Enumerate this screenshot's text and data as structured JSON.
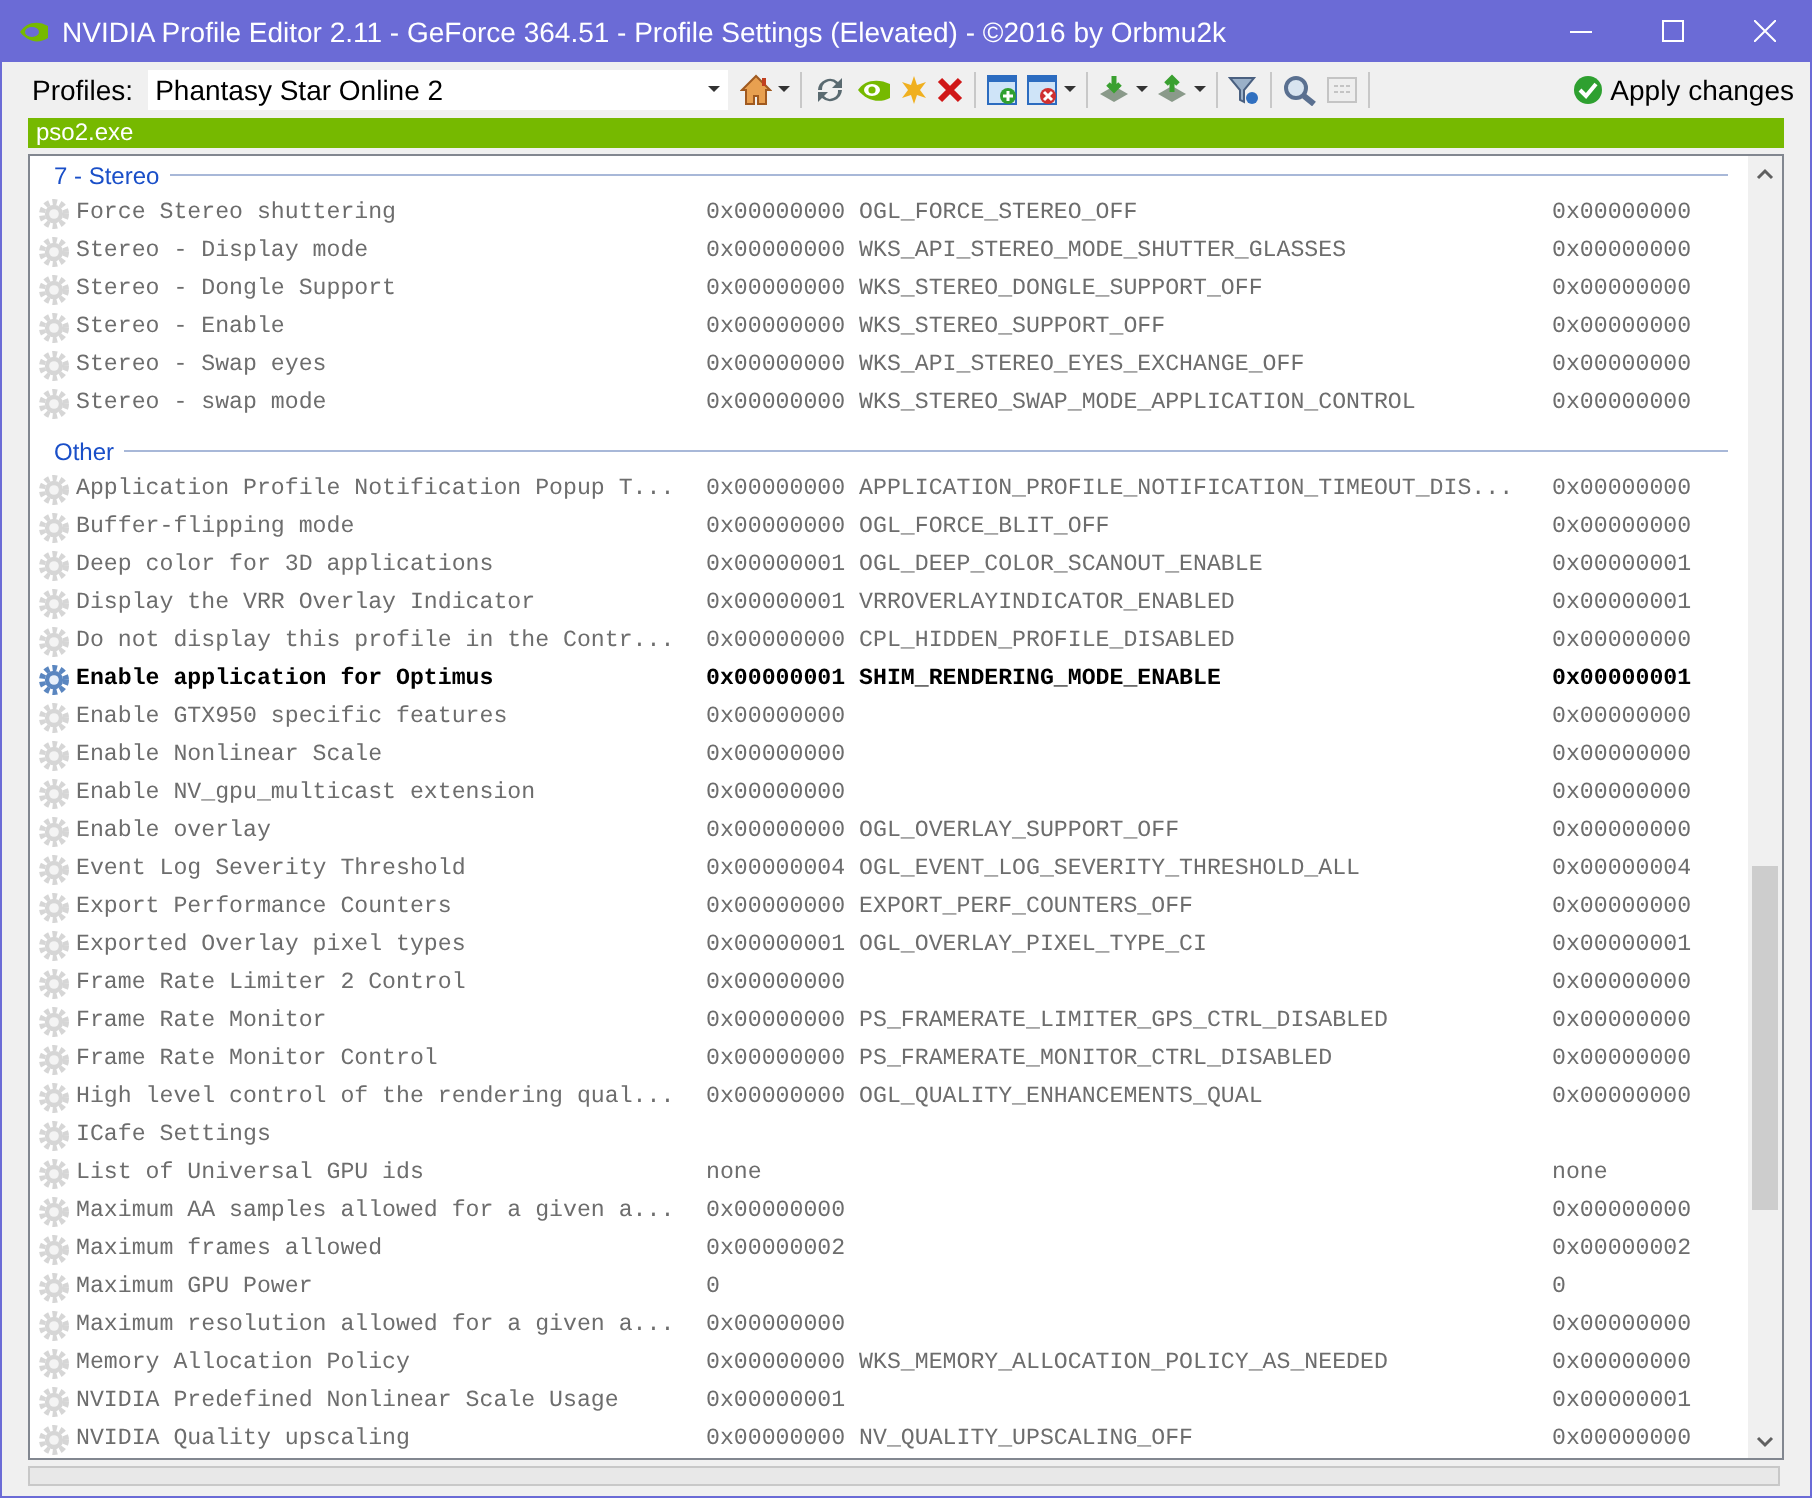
{
  "window": {
    "title": "NVIDIA Profile Editor 2.11 - GeForce 364.51 - Profile Settings (Elevated) - ©2016 by Orbmu2k"
  },
  "toolbar": {
    "profiles_label": "Profiles:",
    "profile": "Phantasy Star Online 2",
    "apply_button": "Apply changes",
    "buttons": [
      {
        "kind": "home",
        "dropdown": true,
        "disabled": false
      },
      {
        "kind": "refresh",
        "dropdown": false,
        "disabled": false
      },
      {
        "kind": "logo",
        "dropdown": false,
        "disabled": false
      },
      {
        "kind": "new",
        "dropdown": false,
        "disabled": false
      },
      {
        "kind": "delete",
        "dropdown": false,
        "disabled": false
      },
      {
        "kind": "add-app",
        "dropdown": false,
        "disabled": false
      },
      {
        "kind": "remove-app",
        "dropdown": true,
        "disabled": false
      },
      {
        "kind": "import",
        "dropdown": true,
        "disabled": false
      },
      {
        "kind": "export",
        "dropdown": true,
        "disabled": false
      },
      {
        "kind": "filter",
        "dropdown": false,
        "disabled": false
      },
      {
        "kind": "scan",
        "dropdown": false,
        "disabled": false
      },
      {
        "kind": "grid",
        "dropdown": false,
        "disabled": true
      }
    ]
  },
  "application_bar": {
    "label": "pso2.exe"
  },
  "groups": [
    {
      "title": "7 - Stereo",
      "rows": [
        {
          "name": "Force Stereo shuttering",
          "value": "0x00000000 OGL_FORCE_STEREO_OFF",
          "default": "0x00000000",
          "configured": false
        },
        {
          "name": "Stereo - Display mode",
          "value": "0x00000000 WKS_API_STEREO_MODE_SHUTTER_GLASSES",
          "default": "0x00000000",
          "configured": false
        },
        {
          "name": "Stereo - Dongle Support",
          "value": "0x00000000 WKS_STEREO_DONGLE_SUPPORT_OFF",
          "default": "0x00000000",
          "configured": false
        },
        {
          "name": "Stereo - Enable",
          "value": "0x00000000 WKS_STEREO_SUPPORT_OFF",
          "default": "0x00000000",
          "configured": false
        },
        {
          "name": "Stereo - Swap eyes",
          "value": "0x00000000 WKS_API_STEREO_EYES_EXCHANGE_OFF",
          "default": "0x00000000",
          "configured": false
        },
        {
          "name": "Stereo - swap mode",
          "value": "0x00000000 WKS_STEREO_SWAP_MODE_APPLICATION_CONTROL",
          "default": "0x00000000",
          "configured": false
        }
      ]
    },
    {
      "title": "Other",
      "rows": [
        {
          "name": "Application Profile Notification Popup T...",
          "value": "0x00000000 APPLICATION_PROFILE_NOTIFICATION_TIMEOUT_DIS...",
          "default": "0x00000000",
          "configured": false
        },
        {
          "name": "Buffer-flipping mode",
          "value": "0x00000000 OGL_FORCE_BLIT_OFF",
          "default": "0x00000000",
          "configured": false
        },
        {
          "name": "Deep color for 3D applications",
          "value": "0x00000001 OGL_DEEP_COLOR_SCANOUT_ENABLE",
          "default": "0x00000001",
          "configured": false
        },
        {
          "name": "Display the VRR Overlay Indicator",
          "value": "0x00000001 VRROVERLAYINDICATOR_ENABLED",
          "default": "0x00000001",
          "configured": false
        },
        {
          "name": "Do not display this profile in the Contr...",
          "value": "0x00000000 CPL_HIDDEN_PROFILE_DISABLED",
          "default": "0x00000000",
          "configured": false
        },
        {
          "name": "Enable application for Optimus",
          "value": "0x00000001 SHIM_RENDERING_MODE_ENABLE",
          "default": "0x00000001",
          "configured": true
        },
        {
          "name": "Enable GTX950 specific features",
          "value": "0x00000000",
          "default": "0x00000000",
          "configured": false
        },
        {
          "name": "Enable Nonlinear Scale",
          "value": "0x00000000",
          "default": "0x00000000",
          "configured": false
        },
        {
          "name": "Enable NV_gpu_multicast extension",
          "value": "0x00000000",
          "default": "0x00000000",
          "configured": false
        },
        {
          "name": "Enable overlay",
          "value": "0x00000000 OGL_OVERLAY_SUPPORT_OFF",
          "default": "0x00000000",
          "configured": false
        },
        {
          "name": "Event Log Severity Threshold",
          "value": "0x00000004 OGL_EVENT_LOG_SEVERITY_THRESHOLD_ALL",
          "default": "0x00000004",
          "configured": false
        },
        {
          "name": "Export Performance Counters",
          "value": "0x00000000 EXPORT_PERF_COUNTERS_OFF",
          "default": "0x00000000",
          "configured": false
        },
        {
          "name": "Exported Overlay pixel types",
          "value": "0x00000001 OGL_OVERLAY_PIXEL_TYPE_CI",
          "default": "0x00000001",
          "configured": false
        },
        {
          "name": "Frame Rate Limiter 2 Control",
          "value": "0x00000000",
          "default": "0x00000000",
          "configured": false
        },
        {
          "name": "Frame Rate Monitor",
          "value": "0x00000000 PS_FRAMERATE_LIMITER_GPS_CTRL_DISABLED",
          "default": "0x00000000",
          "configured": false
        },
        {
          "name": "Frame Rate Monitor Control",
          "value": "0x00000000 PS_FRAMERATE_MONITOR_CTRL_DISABLED",
          "default": "0x00000000",
          "configured": false
        },
        {
          "name": "High level control of the rendering qual...",
          "value": "0x00000000 OGL_QUALITY_ENHANCEMENTS_QUAL",
          "default": "0x00000000",
          "configured": false
        },
        {
          "name": "ICafe Settings",
          "configured": false
        },
        {
          "name": "List of Universal GPU ids",
          "value": "none",
          "default": "none",
          "configured": false
        },
        {
          "name": "Maximum AA samples allowed for a given a...",
          "value": "0x00000000",
          "default": "0x00000000",
          "configured": false
        },
        {
          "name": "Maximum frames allowed",
          "value": "0x00000002",
          "default": "0x00000002",
          "configured": false
        },
        {
          "name": "Maximum GPU Power",
          "value": "0",
          "default": "0",
          "configured": false
        },
        {
          "name": "Maximum resolution allowed for a given a...",
          "value": "0x00000000",
          "default": "0x00000000",
          "configured": false
        },
        {
          "name": "Memory Allocation Policy",
          "value": "0x00000000 WKS_MEMORY_ALLOCATION_POLICY_AS_NEEDED",
          "default": "0x00000000",
          "configured": false
        },
        {
          "name": "NVIDIA Predefined Nonlinear Scale Usage",
          "value": "0x00000001",
          "default": "0x00000001",
          "configured": false
        },
        {
          "name": "NVIDIA Quality upscaling",
          "value": "0x00000000 NV_QUALITY_UPSCALING_OFF",
          "default": "0x00000000",
          "configured": false
        }
      ]
    }
  ]
}
